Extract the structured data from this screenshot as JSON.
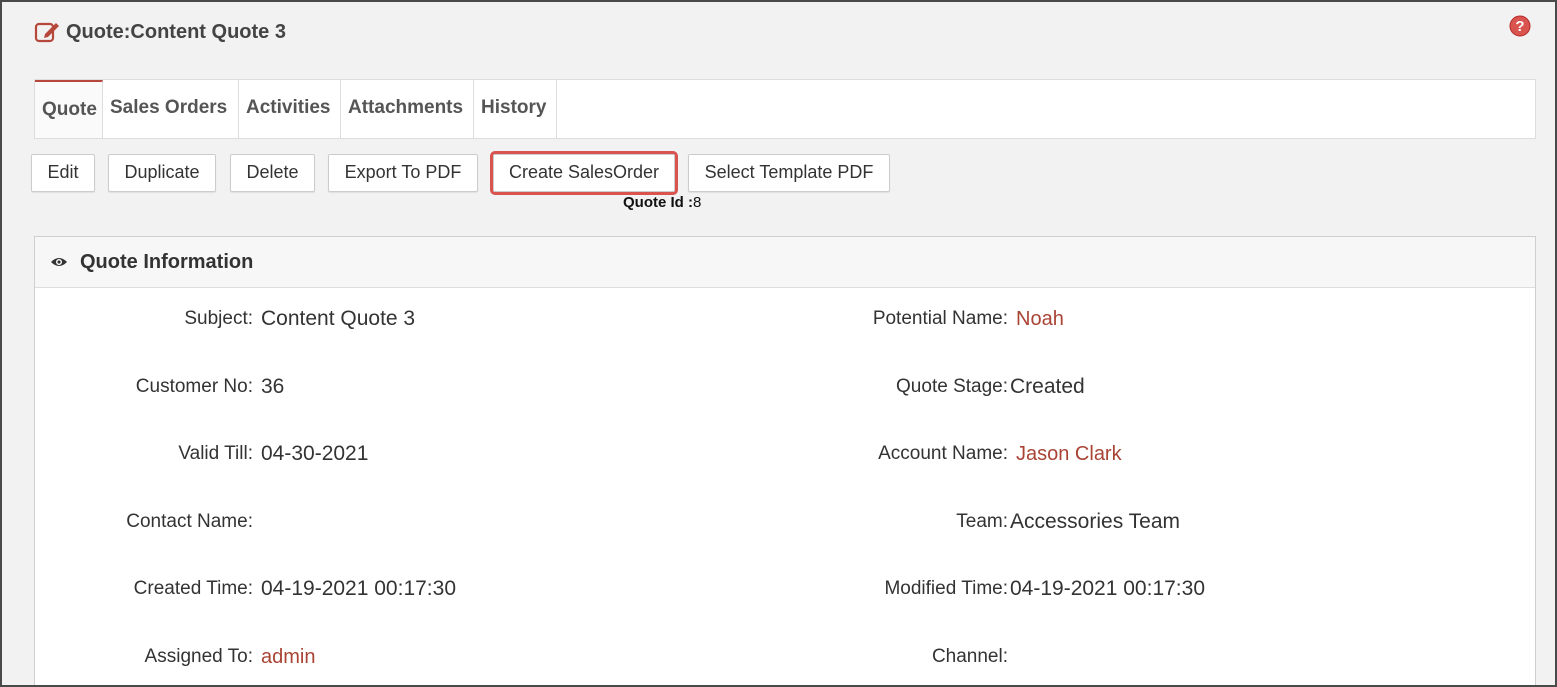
{
  "header": {
    "title": "Quote:Content Quote 3"
  },
  "tabs": [
    {
      "label": "Quote",
      "active": true
    },
    {
      "label": "Sales Orders",
      "active": false
    },
    {
      "label": "Activities",
      "active": false
    },
    {
      "label": "Attachments",
      "active": false
    },
    {
      "label": "History",
      "active": false
    }
  ],
  "toolbar": {
    "edit_label": "Edit",
    "duplicate_label": "Duplicate",
    "delete_label": "Delete",
    "export_pdf_label": "Export To PDF",
    "create_salesorder_label": "Create SalesOrder",
    "select_template_label": "Select Template PDF"
  },
  "quote_id": {
    "label": "Quote Id :",
    "value": "8"
  },
  "panel": {
    "title": "Quote Information"
  },
  "fields": {
    "subject": {
      "label": "Subject:",
      "value": "Content Quote 3"
    },
    "potential_name": {
      "label": "Potential Name:",
      "value": "Noah"
    },
    "customer_no": {
      "label": "Customer No:",
      "value": "36"
    },
    "quote_stage": {
      "label": "Quote Stage:",
      "value": "Created"
    },
    "valid_till": {
      "label": "Valid Till:",
      "value": "04-30-2021"
    },
    "account_name": {
      "label": "Account Name:",
      "value": "Jason Clark"
    },
    "contact_name": {
      "label": "Contact Name:",
      "value": ""
    },
    "team": {
      "label": "Team:",
      "value": "Accessories Team"
    },
    "created_time": {
      "label": "Created Time:",
      "value": "04-19-2021 00:17:30"
    },
    "modified_time": {
      "label": "Modified Time:",
      "value": "04-19-2021 00:17:30"
    },
    "assigned_to": {
      "label": "Assigned To:",
      "value": "admin"
    },
    "channel": {
      "label": "Channel:",
      "value": ""
    }
  },
  "colors": {
    "accent": "#b5483a",
    "link": "#a94435",
    "help": "#d9534f"
  }
}
